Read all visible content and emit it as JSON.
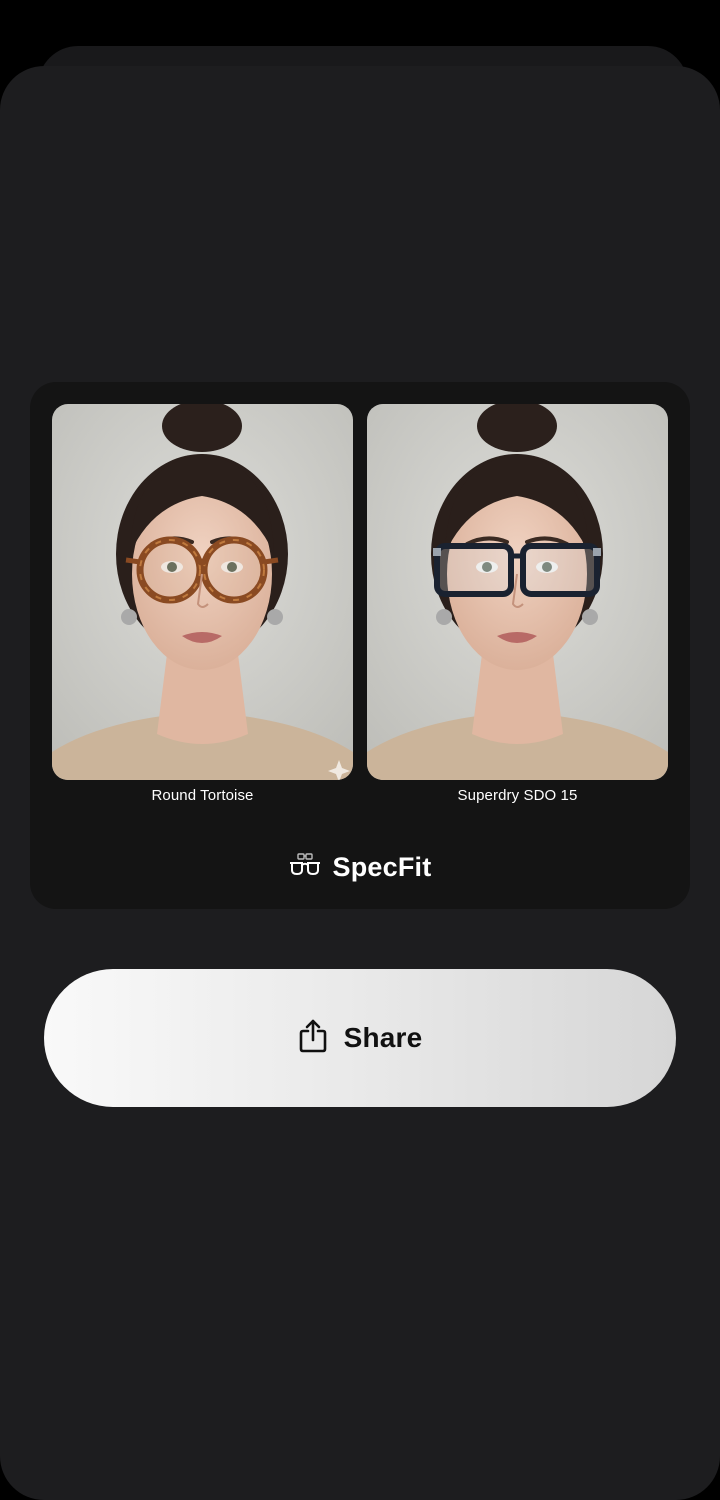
{
  "comparison": {
    "items": [
      {
        "label": "Round Tortoise",
        "frame_color": "#8a4a22",
        "frame_style": "round"
      },
      {
        "label": "Superdry SDO 15",
        "frame_color": "#1a2230",
        "frame_style": "rectangular"
      }
    ]
  },
  "brand": {
    "name": "SpecFit",
    "icon": "glasses-icon"
  },
  "share_button": {
    "label": "Share",
    "icon": "share-icon"
  },
  "colors": {
    "background": "#1d1d1f",
    "card": "#141414",
    "button_start": "#f9f9f9",
    "button_end": "#d6d6d6"
  }
}
